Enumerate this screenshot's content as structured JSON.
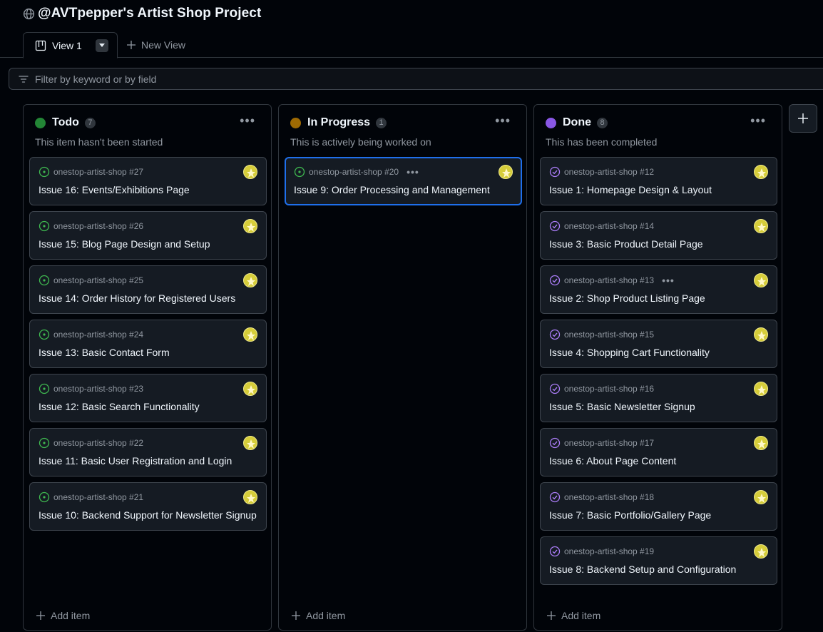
{
  "header": {
    "title": "@AVTpepper's Artist Shop Project"
  },
  "tabs": {
    "active": "View 1",
    "new_view": "New View"
  },
  "filter": {
    "placeholder": "Filter by keyword or by field"
  },
  "colors": {
    "todo": "#238636",
    "in_progress": "#9e6a03",
    "done": "#8957e5",
    "open_issue": "#3fb950",
    "closed_issue": "#ab7df8",
    "selected_border": "#1f6feb"
  },
  "columns": [
    {
      "name": "Todo",
      "count": "7",
      "description": "This item hasn't been started",
      "add_label": "Add item",
      "cards": [
        {
          "repo": "onestop-artist-shop #27",
          "title": "Issue 16: Events/Exhibitions Page"
        },
        {
          "repo": "onestop-artist-shop #26",
          "title": "Issue 15: Blog Page Design and Setup"
        },
        {
          "repo": "onestop-artist-shop #25",
          "title": "Issue 14: Order History for Registered Users"
        },
        {
          "repo": "onestop-artist-shop #24",
          "title": "Issue 13: Basic Contact Form"
        },
        {
          "repo": "onestop-artist-shop #23",
          "title": "Issue 12: Basic Search Functionality"
        },
        {
          "repo": "onestop-artist-shop #22",
          "title": "Issue 11: Basic User Registration and Login"
        },
        {
          "repo": "onestop-artist-shop #21",
          "title": "Issue 10: Backend Support for Newsletter Signup"
        }
      ]
    },
    {
      "name": "In Progress",
      "count": "1",
      "description": "This is actively being worked on",
      "add_label": "Add item",
      "cards": [
        {
          "repo": "onestop-artist-shop #20",
          "title": "Issue 9: Order Processing and Management"
        }
      ]
    },
    {
      "name": "Done",
      "count": "8",
      "description": "This has been completed",
      "add_label": "Add item",
      "cards": [
        {
          "repo": "onestop-artist-shop #12",
          "title": "Issue 1: Homepage Design & Layout"
        },
        {
          "repo": "onestop-artist-shop #14",
          "title": "Issue 3: Basic Product Detail Page"
        },
        {
          "repo": "onestop-artist-shop #13",
          "title": "Issue 2: Shop Product Listing Page"
        },
        {
          "repo": "onestop-artist-shop #15",
          "title": "Issue 4: Shopping Cart Functionality"
        },
        {
          "repo": "onestop-artist-shop #16",
          "title": "Issue 5: Basic Newsletter Signup"
        },
        {
          "repo": "onestop-artist-shop #17",
          "title": "Issue 6: About Page Content"
        },
        {
          "repo": "onestop-artist-shop #18",
          "title": "Issue 7: Basic Portfolio/Gallery Page"
        },
        {
          "repo": "onestop-artist-shop #19",
          "title": "Issue 8: Backend Setup and Configuration"
        }
      ]
    }
  ]
}
